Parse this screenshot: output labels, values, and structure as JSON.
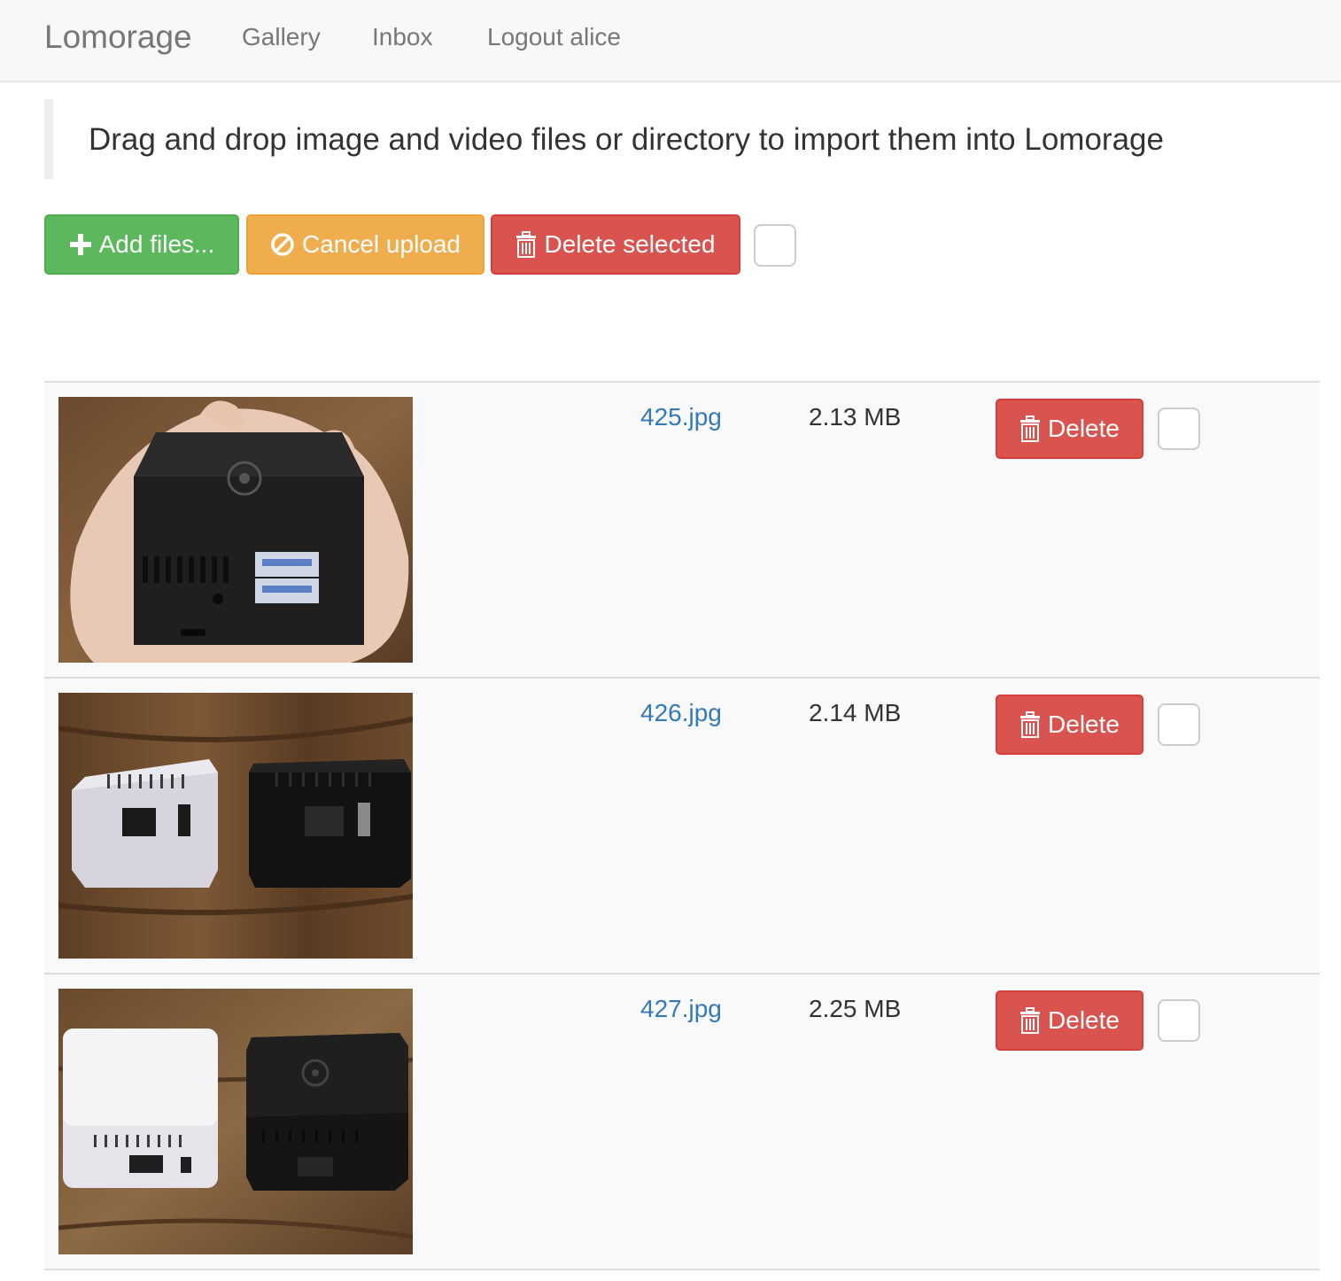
{
  "navbar": {
    "brand": "Lomorage",
    "links": [
      "Gallery",
      "Inbox",
      "Logout alice"
    ]
  },
  "callout": {
    "text": "Drag and drop image and video files or directory to import them into Lomorage"
  },
  "toolbar": {
    "add_label": "Add files...",
    "cancel_label": "Cancel upload",
    "delete_selected_label": "Delete selected",
    "select_all_checked": false
  },
  "files": [
    {
      "name": "425.jpg",
      "size": "2.13 MB",
      "delete_label": "Delete",
      "checked": false
    },
    {
      "name": "426.jpg",
      "size": "2.14 MB",
      "delete_label": "Delete",
      "checked": false
    },
    {
      "name": "427.jpg",
      "size": "2.25 MB",
      "delete_label": "Delete",
      "checked": false
    }
  ],
  "colors": {
    "success": "#5cb85c",
    "warning": "#f0ad4e",
    "danger": "#d9534f",
    "link": "#337ab7"
  },
  "icons": {
    "add": "plus-icon",
    "cancel": "ban-icon",
    "delete": "trash-icon"
  }
}
